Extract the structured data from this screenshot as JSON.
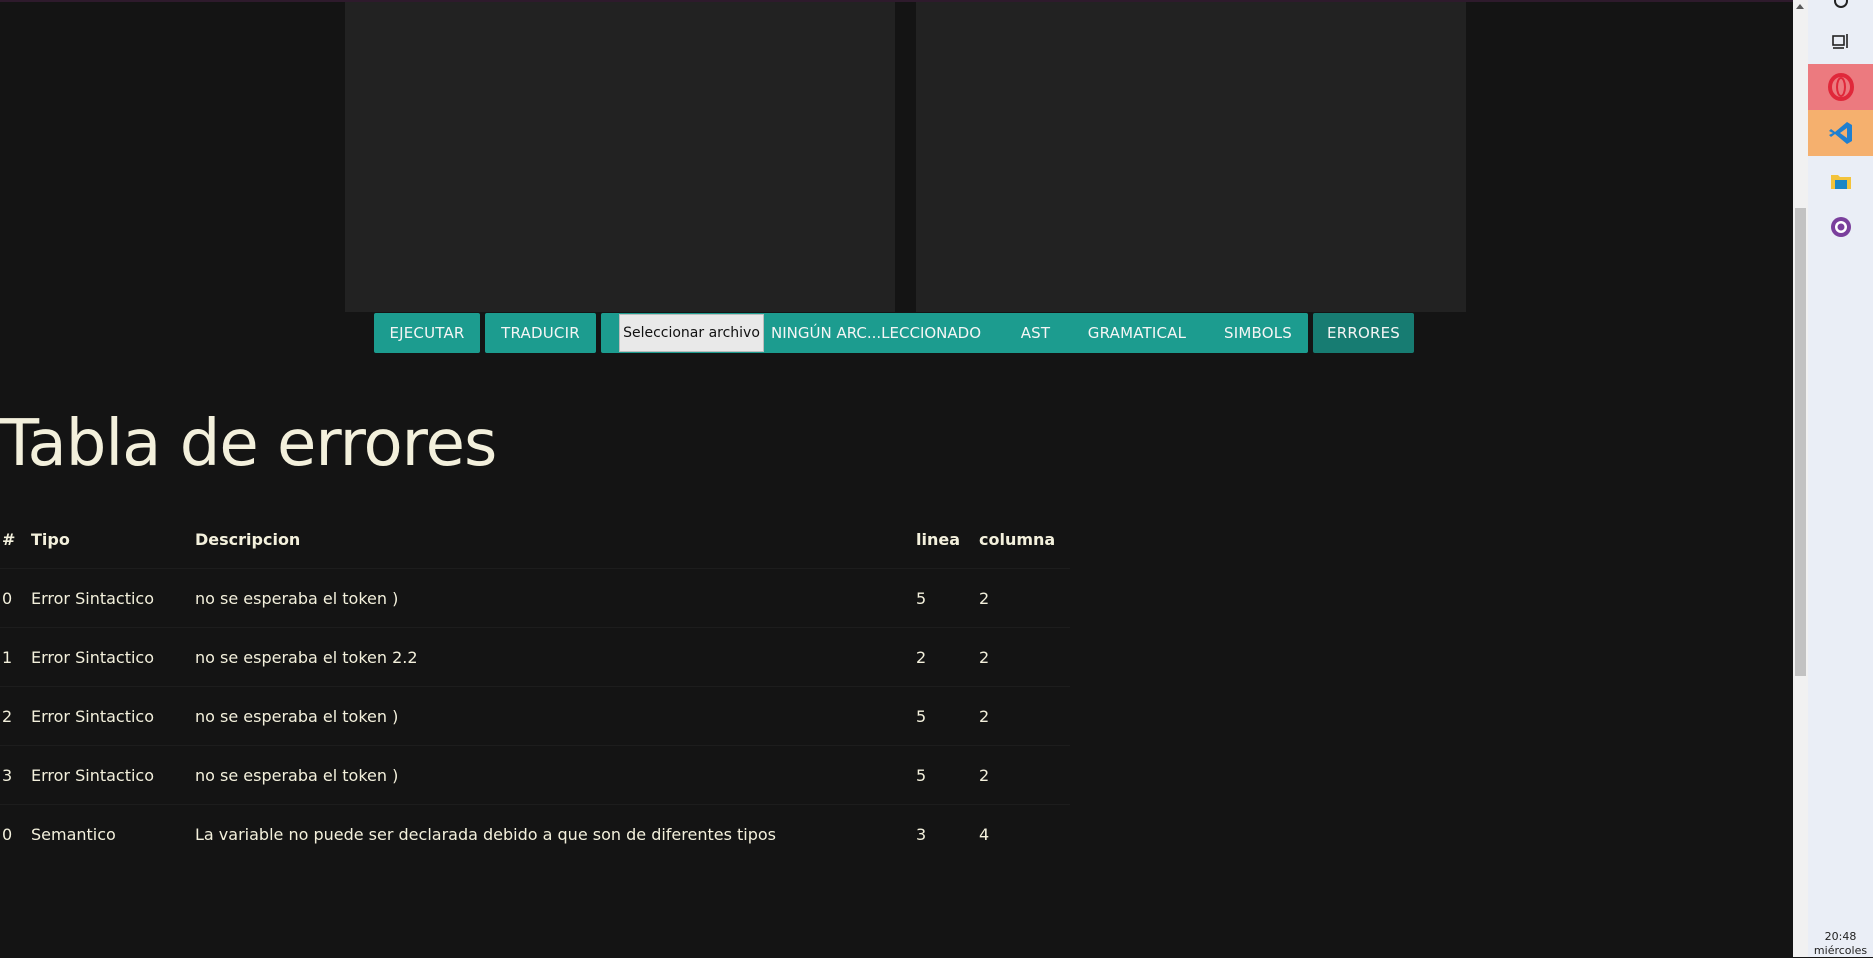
{
  "toolbar": {
    "buttons": [
      {
        "label": "EJECUTAR"
      },
      {
        "label": "TRADUCIR"
      },
      {
        "label": "AST"
      },
      {
        "label": "GRAMATICAL"
      },
      {
        "label": "SIMBOLS"
      },
      {
        "label": "ERRORES"
      }
    ],
    "file_input": {
      "button_label": "Seleccionar archivo",
      "status": "NINGÚN ARC...LECCIONADO"
    }
  },
  "page_title": "Tabla de errores",
  "error_table": {
    "headers": [
      "#",
      "Tipo",
      "Descripcion",
      "linea",
      "columna"
    ],
    "rows": [
      [
        "0",
        "Error Sintactico",
        "no se esperaba el token )",
        "5",
        "2"
      ],
      [
        "1",
        "Error Sintactico",
        "no se esperaba el token 2.2",
        "2",
        "2"
      ],
      [
        "2",
        "Error Sintactico",
        "no se esperaba el token )",
        "5",
        "2"
      ],
      [
        "3",
        "Error Sintactico",
        "no se esperaba el token )",
        "5",
        "2"
      ],
      [
        "0",
        "Semantico",
        "La variable no puede ser declarada debido a que son de diferentes tipos",
        "3",
        "4"
      ]
    ]
  },
  "taskbar": {
    "icons": [
      "record-icon",
      "task-view-icon",
      "opera-icon",
      "vscode-icon",
      "file-explorer-icon",
      "github-desktop-icon"
    ],
    "clock_time": "20:48",
    "clock_day": "miércoles"
  },
  "colors": {
    "background": "#141414",
    "editor": "#222222",
    "button": "#1c9c8f",
    "button_active": "#177c72",
    "text": "#f3f0dc"
  }
}
